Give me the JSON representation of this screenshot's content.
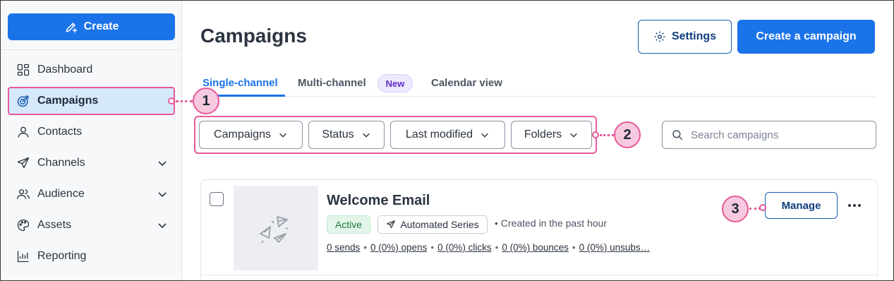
{
  "sidebar": {
    "create_label": "Create",
    "items": [
      {
        "label": "Dashboard",
        "icon": "dashboard-icon",
        "expandable": false,
        "active": false
      },
      {
        "label": "Campaigns",
        "icon": "target-icon",
        "expandable": false,
        "active": true
      },
      {
        "label": "Contacts",
        "icon": "person-icon",
        "expandable": false,
        "active": false
      },
      {
        "label": "Channels",
        "icon": "paper-plane-icon",
        "expandable": true,
        "active": false
      },
      {
        "label": "Audience",
        "icon": "people-icon",
        "expandable": true,
        "active": false
      },
      {
        "label": "Assets",
        "icon": "palette-icon",
        "expandable": true,
        "active": false
      },
      {
        "label": "Reporting",
        "icon": "chart-icon",
        "expandable": false,
        "active": false
      }
    ]
  },
  "header": {
    "title": "Campaigns",
    "settings_label": "Settings",
    "create_campaign_label": "Create a campaign"
  },
  "tabs": [
    {
      "label": "Single-channel",
      "active": true
    },
    {
      "label": "Multi-channel",
      "active": false,
      "badge": "New"
    },
    {
      "label": "Calendar view",
      "active": false
    }
  ],
  "filters": [
    {
      "label": "Campaigns"
    },
    {
      "label": "Status"
    },
    {
      "label": "Last modified"
    },
    {
      "label": "Folders"
    }
  ],
  "search": {
    "placeholder": "Search campaigns"
  },
  "campaign": {
    "name": "Welcome Email",
    "status": "Active",
    "type": "Automated Series",
    "created": "Created in the past hour",
    "stats": {
      "sends": "0 sends",
      "opens": "0 (0%) opens",
      "clicks": "0 (0%) clicks",
      "bounces": "0 (0%) bounces",
      "unsubs": "0 (0%) unsubs…"
    },
    "manage_label": "Manage"
  },
  "callouts": {
    "one": "1",
    "two": "2",
    "three": "3"
  },
  "colors": {
    "primary": "#1a73e8",
    "highlight": "#e85a9b",
    "active_nav_bg": "#d6e8fb",
    "status_green": "#1d7a3d",
    "new_badge_purple": "#5b2ec6"
  }
}
